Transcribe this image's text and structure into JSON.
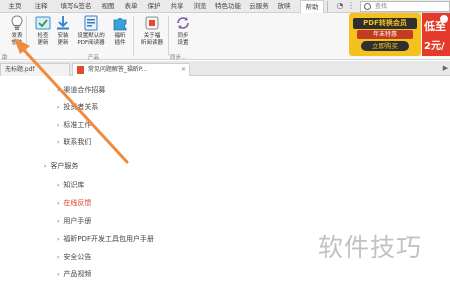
{
  "menu": {
    "tabs": [
      "主页",
      "注释",
      "填写&签名",
      "视图",
      "表单",
      "保护",
      "共享",
      "浏览",
      "特色功能",
      "云服务",
      "放映",
      "帮助"
    ],
    "active_tab": "帮助",
    "search_placeholder": "查找"
  },
  "ribbon": {
    "buttons": [
      {
        "label1": "发表",
        "label2": "想法"
      },
      {
        "label1": "检查",
        "label2": "更新"
      },
      {
        "label1": "安装",
        "label2": "更新"
      },
      {
        "label1": "设置默认的",
        "label2": "PDF阅读器"
      },
      {
        "label1": "福昕",
        "label2": "插件"
      },
      {
        "label1": "关于福",
        "label2": "昕阅读器"
      },
      {
        "label1": "同步",
        "label2": "设置"
      }
    ],
    "groups": [
      "助",
      "产品",
      "同步..."
    ]
  },
  "promo": {
    "title": "PDF转换会员",
    "subtitle": "年末特惠",
    "cta": "立即购买",
    "side1": "低至",
    "side2": "2元/"
  },
  "doc_tabs": [
    {
      "label": "无标题.pdf"
    },
    {
      "label": "常见问题解答_福昕P..."
    }
  ],
  "content": {
    "items": [
      {
        "text": "渠道合作招募"
      },
      {
        "text": "投资者关系"
      },
      {
        "text": "标准工作"
      },
      {
        "text": "联系我们"
      },
      {
        "text": "客户服务"
      },
      {
        "text": "知识库"
      },
      {
        "text": "在线反馈"
      },
      {
        "text": "用户手册"
      },
      {
        "text": "福昕PDF开发工具包用户手册"
      },
      {
        "text": "安全公告"
      },
      {
        "text": "产品视频"
      }
    ],
    "watermark": "软件技巧"
  },
  "colors": {
    "arrow": "#f08a3c",
    "accent_red": "#e03a2a",
    "promo_yellow": "#f3c21f"
  }
}
